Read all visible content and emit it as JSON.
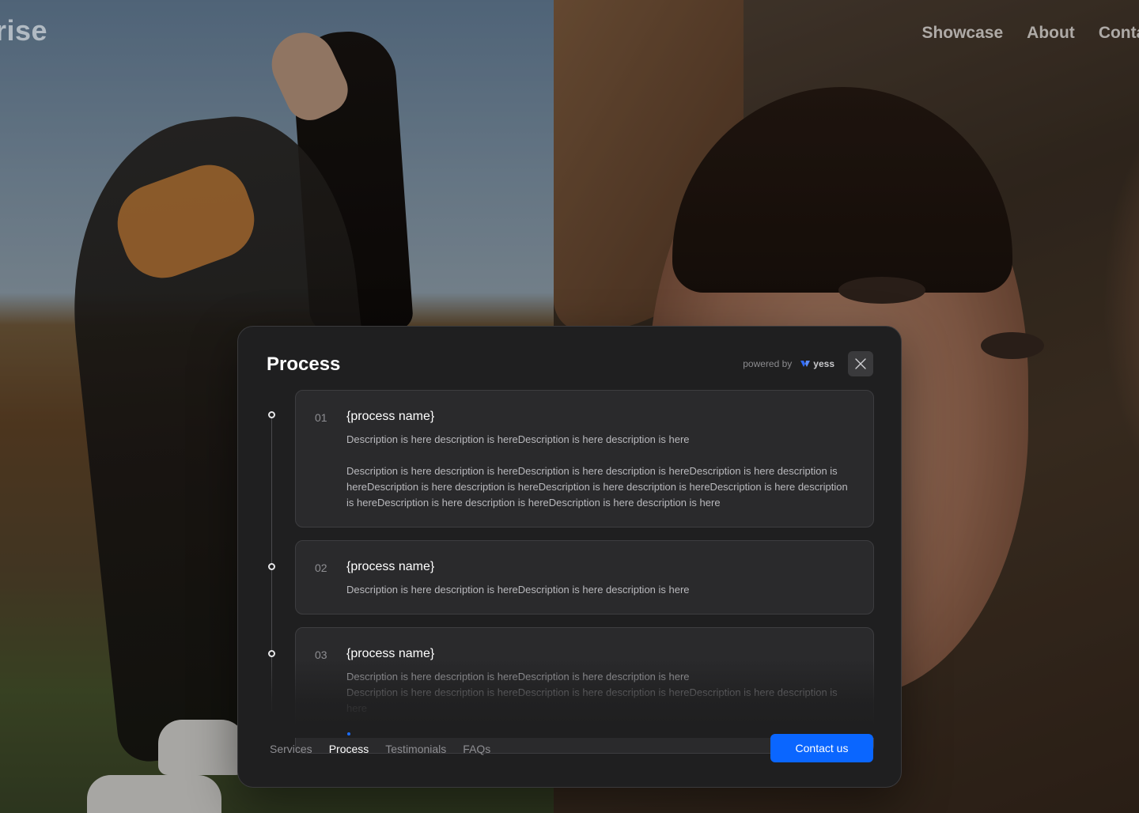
{
  "site": {
    "logo_text": "rise",
    "nav": [
      {
        "label": "Showcase"
      },
      {
        "label": "About"
      },
      {
        "label": "Contac"
      }
    ]
  },
  "modal": {
    "title": "Process",
    "powered_by": "powered by",
    "brand": "yess",
    "close_icon": "close-icon",
    "steps": [
      {
        "number": "01",
        "name": "{process name}",
        "paragraphs": [
          "Description is here description is hereDescription is here description is here",
          "Description is here description is hereDescription is here description is hereDescription is here description is hereDescription is here description is hereDescription is here description is hereDescription is here description is hereDescription is here description is hereDescription is here description is here"
        ]
      },
      {
        "number": "02",
        "name": "{process name}",
        "paragraphs": [
          "Description is here description is hereDescription is here description is here"
        ]
      },
      {
        "number": "03",
        "name": "{process name}",
        "paragraphs": [
          "Description is here description is hereDescription is here description is here",
          "Description is here description is hereDescription is here description is hereDescription is here description is here"
        ]
      }
    ],
    "tabs": [
      {
        "label": "Services",
        "active": false
      },
      {
        "label": "Process",
        "active": true
      },
      {
        "label": "Testimonials",
        "active": false
      },
      {
        "label": "FAQs",
        "active": false
      }
    ],
    "cta_label": "Contact us",
    "colors": {
      "accent": "#0a66ff",
      "modal_bg": "#1f1f20",
      "card_bg": "#2a2a2c"
    }
  }
}
